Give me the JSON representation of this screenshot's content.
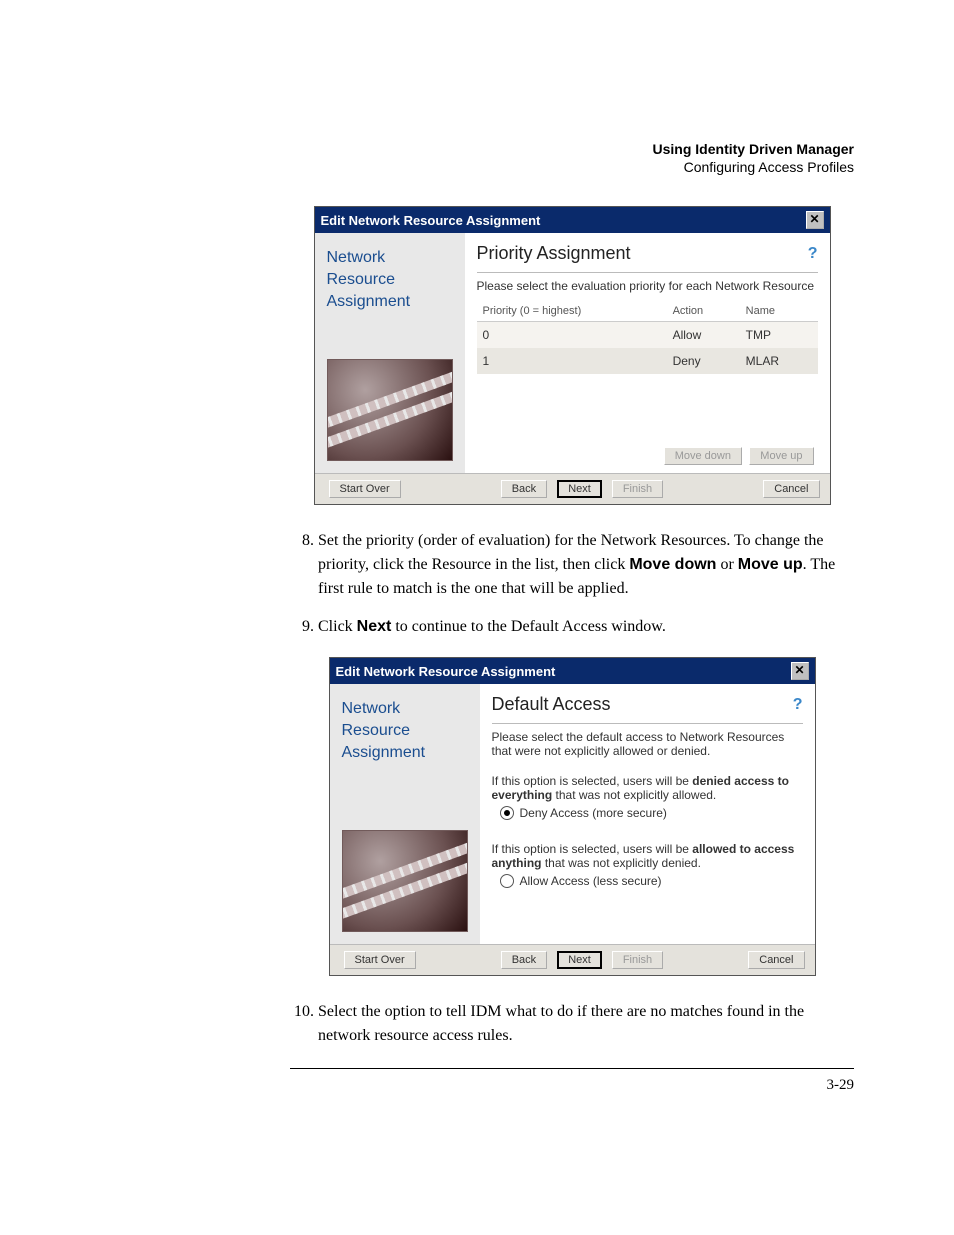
{
  "header": {
    "title_bold": "Using Identity Driven Manager",
    "subtitle": "Configuring Access Profiles"
  },
  "dialog1": {
    "title": "Edit Network Resource Assignment",
    "sidebar_title": "Network Resource Assignment",
    "heading": "Priority Assignment",
    "instruction": "Please select the evaluation priority for each Network Resource",
    "columns": {
      "c1": "Priority (0 = highest)",
      "c2": "Action",
      "c3": "Name"
    },
    "rows": [
      {
        "priority": "0",
        "action": "Allow",
        "name": "TMP"
      },
      {
        "priority": "1",
        "action": "Deny",
        "name": "MLAR"
      }
    ],
    "buttons": {
      "move_down": "Move down",
      "move_up": "Move up",
      "start_over": "Start Over",
      "back": "Back",
      "next": "Next",
      "finish": "Finish",
      "cancel": "Cancel"
    }
  },
  "steps_a": {
    "s8_a": "Set the priority (order of evaluation) for the Network Resources. To change the priority, click the Resource in the list, then click ",
    "s8_b": "Move down",
    "s8_c": " or ",
    "s8_d": "Move up",
    "s8_e": ". The first rule to match is the one that will be applied.",
    "s9_a": "Click ",
    "s9_b": "Next",
    "s9_c": " to continue to the Default Access window."
  },
  "dialog2": {
    "title": "Edit Network Resource Assignment",
    "sidebar_title": "Network Resource Assignment",
    "heading": "Default Access",
    "instruction": "Please select the default access to Network Resources that were not explicitly allowed or denied.",
    "deny_pre": "If this option is selected, users will be ",
    "deny_bold1": "denied access to everything",
    "deny_post": " that was not explicitly allowed.",
    "deny_label": "Deny Access   (more secure)",
    "allow_pre": "If this option is selected, users will be ",
    "allow_bold1": "allowed to access anything",
    "allow_post": " that was not explicitly denied.",
    "allow_label": "Allow Access   (less secure)",
    "buttons": {
      "start_over": "Start Over",
      "back": "Back",
      "next": "Next",
      "finish": "Finish",
      "cancel": "Cancel"
    }
  },
  "steps_b": {
    "s10": "Select the option to tell IDM what to do if there are no matches found in the network resource access rules."
  },
  "page_number": "3-29"
}
